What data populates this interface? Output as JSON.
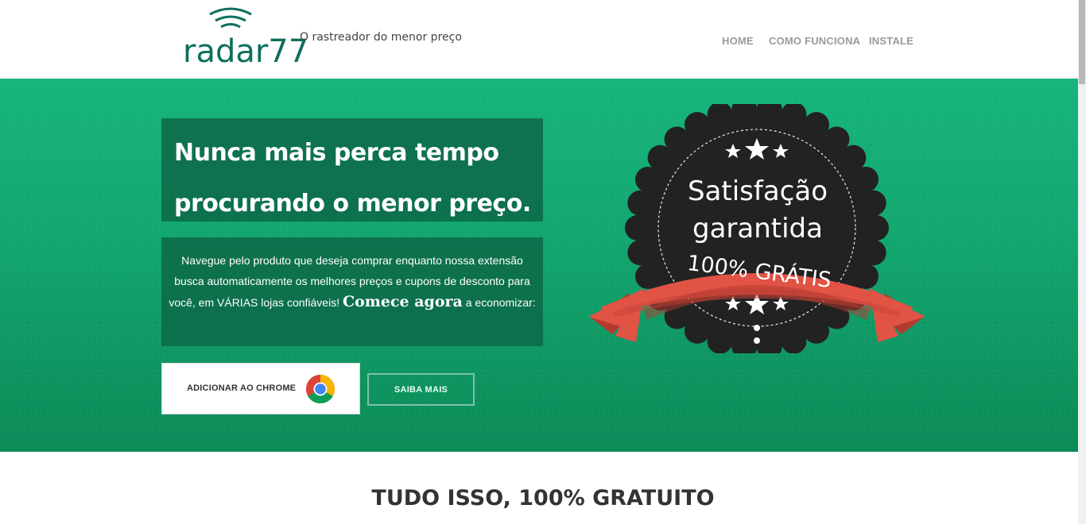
{
  "header": {
    "logo_text": "radar77",
    "tagline": "O rastreador do menor preço",
    "nav": [
      {
        "label": "HOME"
      },
      {
        "label": "COMO FUNCIONA"
      },
      {
        "label": "INSTALE"
      }
    ]
  },
  "hero": {
    "headline_line1": "Nunca mais perca tempo",
    "headline_line2": "procurando o menor preço.",
    "description_part1": "Navegue pelo produto que deseja comprar enquanto nossa extensão busca automaticamente os melhores preços e cupons de desconto para você, em VÁRIAS lojas confiáveis!",
    "description_emphasis": "Comece agora",
    "description_part2": "a economizar:",
    "chrome_button_label": "ADICIONAR AO CHROME",
    "learn_more_label": "SAIBA MAIS",
    "badge": {
      "line1": "Satisfação",
      "line2": "garantida",
      "ribbon": "100% GRÁTIS"
    }
  },
  "section": {
    "title": "TUDO ISSO, 100% GRATUITO"
  },
  "colors": {
    "brand": "#0e6e5c",
    "hero_green": "#13a870",
    "ribbon_red": "#e05345",
    "badge_dark": "#2b2b2b"
  }
}
